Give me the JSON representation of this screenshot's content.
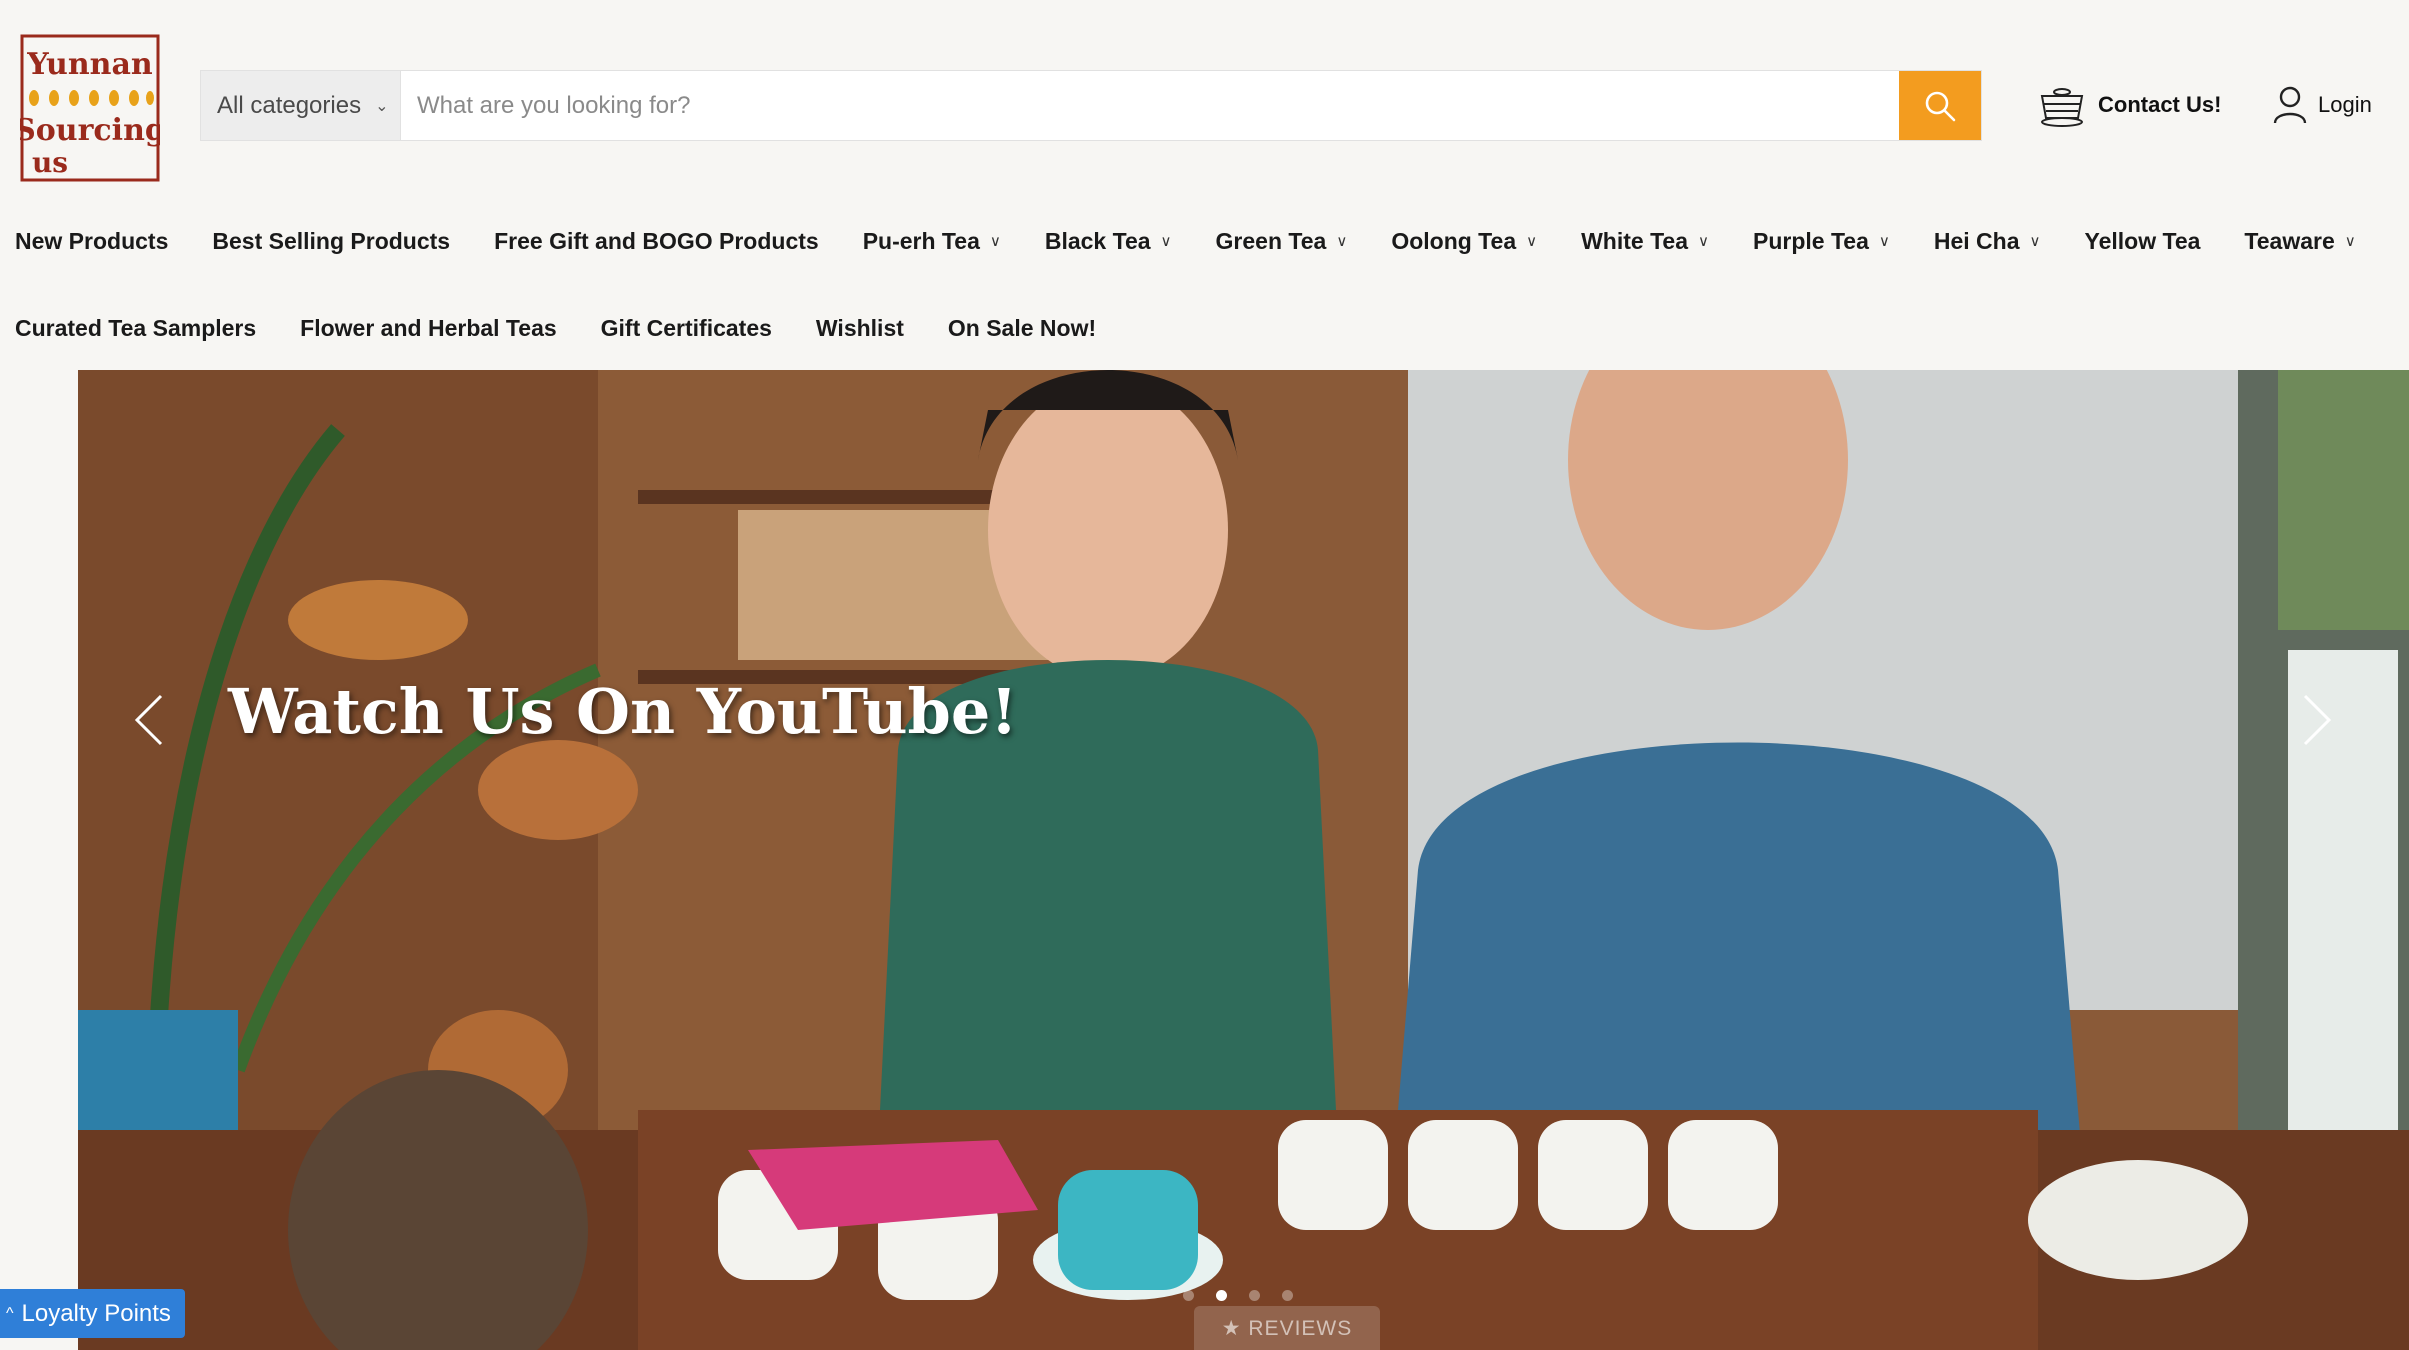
{
  "header": {
    "logo": {
      "line1": "Yunnan",
      "line2": "Sourcing",
      "line3": "us"
    },
    "search": {
      "category_selected": "All categories",
      "placeholder": "What are you looking for?",
      "value": ""
    },
    "contact_label": "Contact Us!",
    "login_label": "Login"
  },
  "nav": {
    "row1": [
      {
        "label": "New Products",
        "dropdown": false
      },
      {
        "label": "Best Selling Products",
        "dropdown": false
      },
      {
        "label": "Free Gift and BOGO Products",
        "dropdown": false
      },
      {
        "label": "Pu-erh Tea",
        "dropdown": true
      },
      {
        "label": "Black Tea",
        "dropdown": true
      },
      {
        "label": "Green Tea",
        "dropdown": true
      },
      {
        "label": "Oolong Tea",
        "dropdown": true
      },
      {
        "label": "White Tea",
        "dropdown": true
      },
      {
        "label": "Purple Tea",
        "dropdown": true
      },
      {
        "label": "Hei Cha",
        "dropdown": true
      },
      {
        "label": "Yellow Tea",
        "dropdown": false
      },
      {
        "label": "Teaware",
        "dropdown": true
      }
    ],
    "row2": [
      {
        "label": "Curated Tea Samplers",
        "dropdown": false
      },
      {
        "label": "Flower and Herbal Teas",
        "dropdown": false
      },
      {
        "label": "Gift Certificates",
        "dropdown": false
      },
      {
        "label": "Wishlist",
        "dropdown": false
      },
      {
        "label": "On Sale Now!",
        "dropdown": false
      }
    ]
  },
  "hero": {
    "title": "Watch Us On YouTube!",
    "slide_count": 4,
    "active_slide": 2,
    "reviews_tab": "★ REVIEWS"
  },
  "loyalty_label": "Loyalty Points",
  "colors": {
    "accent": "#f39c1f",
    "logo_red": "#9a2a1c",
    "logo_gold": "#e8a21a",
    "loyalty_blue": "#2f7fd8",
    "background": "#f7f6f3"
  },
  "icons": {
    "search": "search-icon",
    "contact": "teapot-icon",
    "login": "user-icon",
    "prev": "chevron-left-icon",
    "next": "chevron-right-icon"
  }
}
